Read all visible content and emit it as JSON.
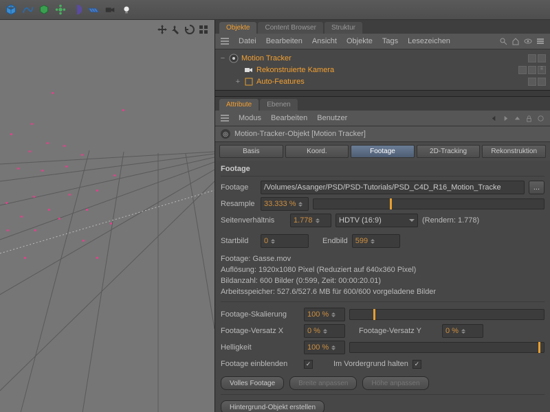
{
  "toolbar_icons": [
    "cube",
    "spline",
    "group",
    "flower",
    "halfmoon",
    "grid",
    "camera",
    "light"
  ],
  "panels": {
    "objects": {
      "tabs": [
        "Objekte",
        "Content Browser",
        "Struktur"
      ],
      "active": 0,
      "menu": [
        "Datei",
        "Bearbeiten",
        "Ansicht",
        "Objekte",
        "Tags",
        "Lesezeichen"
      ],
      "tree": [
        {
          "label": "Motion Tracker",
          "indent": 0,
          "toggle": "−"
        },
        {
          "label": "Rekonstruierte Kamera",
          "indent": 1,
          "toggle": ""
        },
        {
          "label": "Auto-Features",
          "indent": 1,
          "toggle": "+"
        }
      ]
    }
  },
  "attr": {
    "tabs": [
      "Attribute",
      "Ebenen"
    ],
    "active": 0,
    "menu": [
      "Modus",
      "Bearbeiten",
      "Benutzer"
    ],
    "object_name": "Motion-Tracker-Objekt [Motion Tracker]",
    "sub_tabs": [
      "Basis",
      "Koord.",
      "Footage",
      "2D-Tracking",
      "Rekonstruktion"
    ],
    "sub_active": 2,
    "section_title": "Footage",
    "footage": {
      "footage_label": "Footage",
      "footage_path": "/Volumes/Asanger/PSD/PSD-Tutorials/PSD_C4D_R16_Motion_Tracke",
      "browse": "...",
      "resample_label": "Resample",
      "resample": "33.333 %",
      "aspect_label": "Seitenverhältnis",
      "aspect": "1.778",
      "aspect_preset": "HDTV (16:9)",
      "render_label": "(Rendern: 1.778)",
      "start_label": "Startbild",
      "start": "0",
      "end_label": "Endbild",
      "end": "599",
      "info1": "Footage: Gasse.mov",
      "info2": "Auflösung: 1920x1080 Pixel (Reduziert auf 640x360 Pixel)",
      "info3": "Bildanzahl: 600 Bilder (0:599, Zeit: 00:00:20.01)",
      "info4": "Arbeitsspeicher: 527.6/527.6 MB für 600/600 vorgeladene Bilder",
      "scale_label": "Footage-Skalierung",
      "scale": "100 %",
      "offx_label": "Footage-Versatz X",
      "offx": "0 %",
      "offy_label": "Footage-Versatz Y",
      "offy": "0 %",
      "bright_label": "Helligkeit",
      "bright": "100 %",
      "show_label": "Footage einblenden",
      "fg_label": "Im Vordergrund halten",
      "btn_full": "Volles Footage",
      "btn_width": "Breite anpassen",
      "btn_height": "Höhe anpassen",
      "btn_bg": "Hintergrund-Objekt erstellen"
    }
  }
}
